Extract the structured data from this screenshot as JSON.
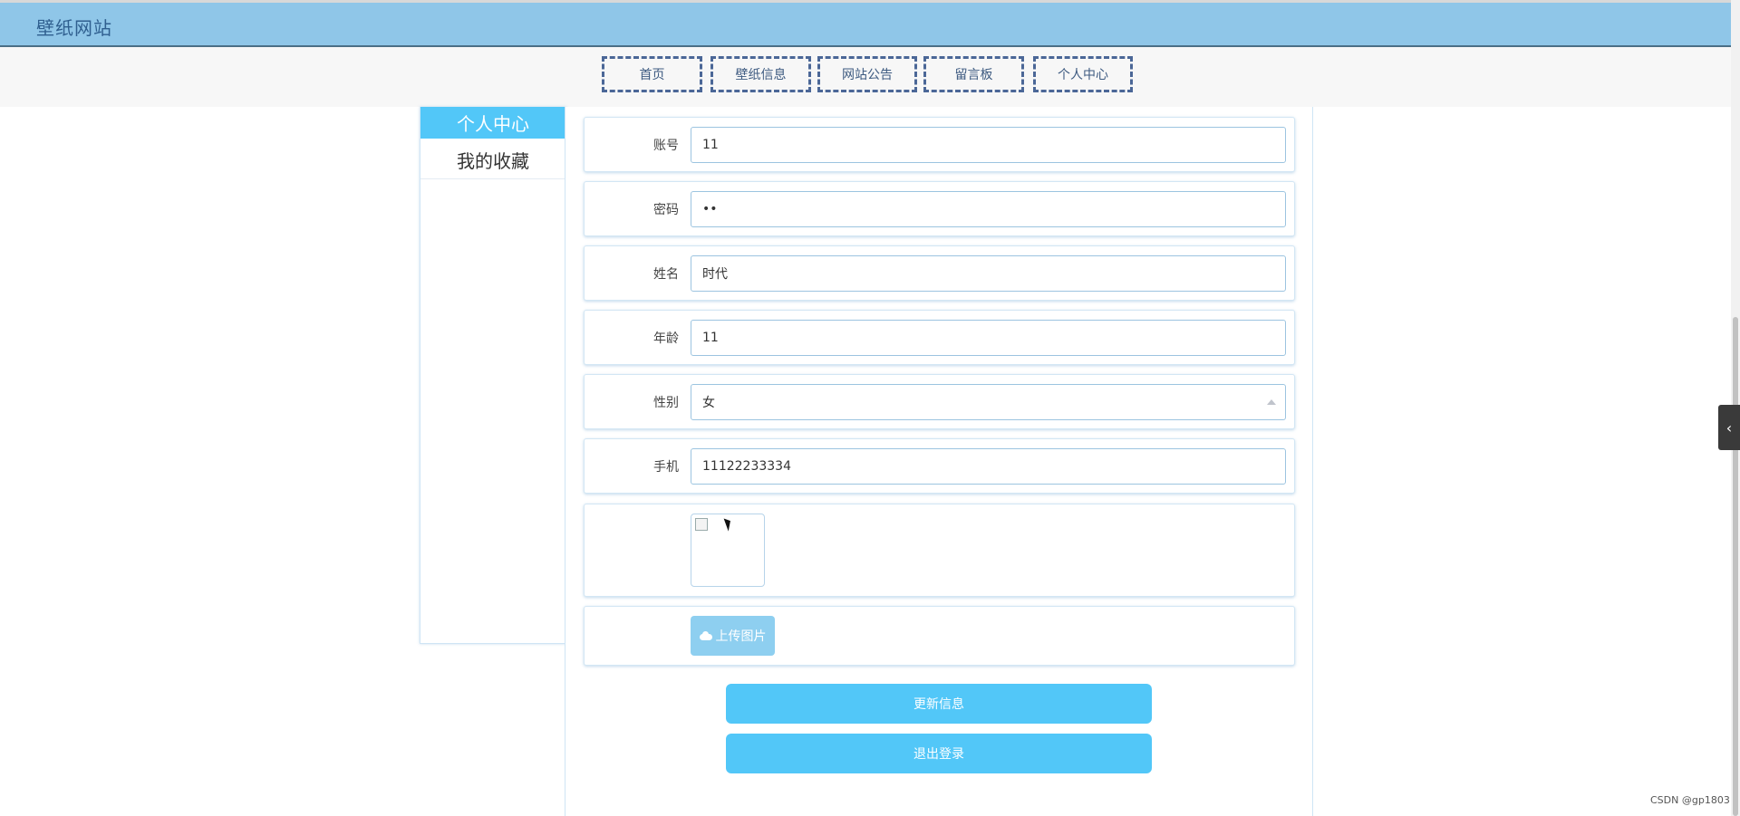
{
  "header": {
    "site_title": "壁纸网站"
  },
  "nav": {
    "items": [
      "首页",
      "壁纸信息",
      "网站公告",
      "留言板",
      "个人中心"
    ]
  },
  "sidebar": {
    "items": [
      {
        "label": "个人中心",
        "active": true
      },
      {
        "label": "我的收藏",
        "active": false
      }
    ]
  },
  "form": {
    "account": {
      "label": "账号",
      "value": "11"
    },
    "password": {
      "label": "密码",
      "value": "••"
    },
    "name": {
      "label": "姓名",
      "value": "时代"
    },
    "age": {
      "label": "年龄",
      "value": "11"
    },
    "gender": {
      "label": "性别",
      "value": "女"
    },
    "phone": {
      "label": "手机",
      "value": "11122233334"
    },
    "upload_label": "上传图片"
  },
  "actions": {
    "update": "更新信息",
    "logout": "退出登录"
  },
  "side_toggle_icon": "chevron-left-icon",
  "watermark": "CSDN @gp1803",
  "colors": {
    "header_bg": "#8fc6e8",
    "accent": "#52c7f8",
    "nav_border": "#4b6797"
  }
}
